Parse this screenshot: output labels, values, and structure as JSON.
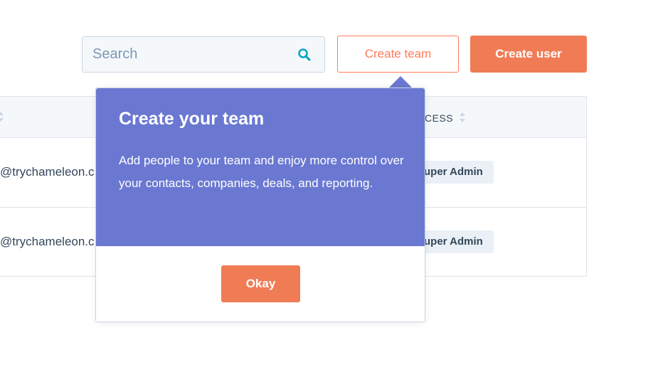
{
  "search": {
    "placeholder": "Search",
    "icon": "search-icon"
  },
  "toolbar": {
    "create_team_label": "Create team",
    "create_user_label": "Create user"
  },
  "table": {
    "columns": [
      {
        "label": ""
      },
      {
        "label": "CESS"
      }
    ],
    "rows": [
      {
        "email": "@trychameleon.c",
        "access": "uper Admin"
      },
      {
        "email": "@trychameleon.c",
        "access": "uper Admin"
      }
    ]
  },
  "popover": {
    "title": "Create your team",
    "body": "Add people to your team and enjoy more control over your contacts, companies, deals, and reporting.",
    "okay_label": "Okay"
  },
  "colors": {
    "accent": "#f07c56",
    "popover": "#6a78d1",
    "text": "#33475b",
    "badge_bg": "#eaf0f6"
  }
}
